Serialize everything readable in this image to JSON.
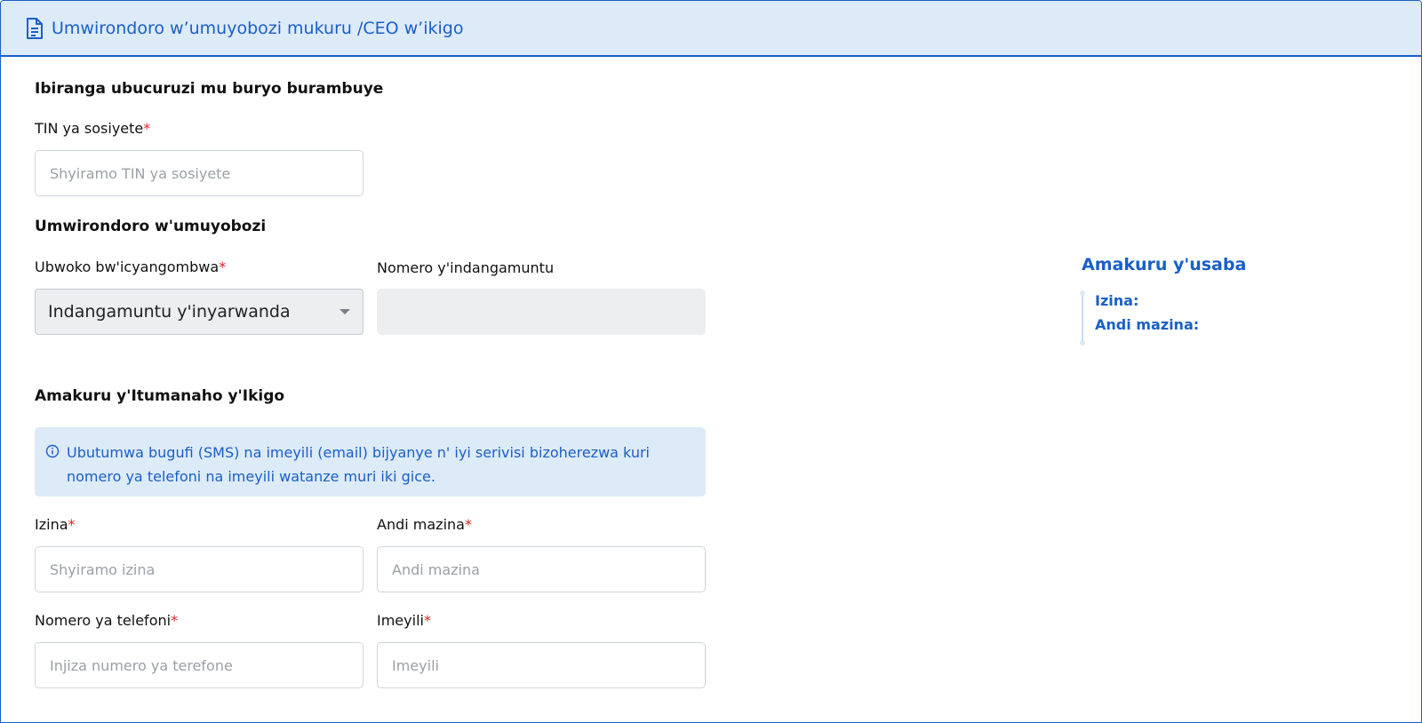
{
  "header": {
    "title": "Umwirondoro w’umuyobozi mukuru /CEO w’ikigo",
    "icon": "document-icon"
  },
  "business": {
    "section_title": "Ibiranga ubucuruzi mu buryo burambuye",
    "tin_label": "TIN ya sosiyete",
    "tin_placeholder": "Shyiramo TIN ya sosiyete"
  },
  "identity": {
    "section_title": "Umwirondoro w'umuyobozi",
    "doc_type_label": "Ubwoko bw'icyangombwa",
    "doc_type_value": "Indangamuntu y'inyarwanda",
    "id_number_label": "Nomero y'indangamuntu",
    "id_number_value": ""
  },
  "contact": {
    "section_title": "Amakuru y'Itumanaho y'Ikigo",
    "info_text": "Ubutumwa bugufi (SMS) na imeyili (email) bijyanye n' iyi serivisi bizoherezwa kuri nomero ya telefoni na imeyili watanze muri iki gice.",
    "first_name_label": "Izina",
    "first_name_placeholder": "Shyiramo izina",
    "last_name_label": "Andi mazina",
    "last_name_placeholder": "Andi mazina",
    "phone_label": "Nomero ya telefoni",
    "phone_placeholder": "Injiza numero ya terefone",
    "email_label": "Imeyili",
    "email_placeholder": "Imeyili"
  },
  "summary": {
    "title": "Amakuru y'usaba",
    "items": [
      "Izina:",
      "Andi mazina:"
    ]
  },
  "required_marker": "*",
  "colors": {
    "accent": "#1a5fc7",
    "header_bg": "#ddeaf8",
    "required": "#e02424"
  }
}
